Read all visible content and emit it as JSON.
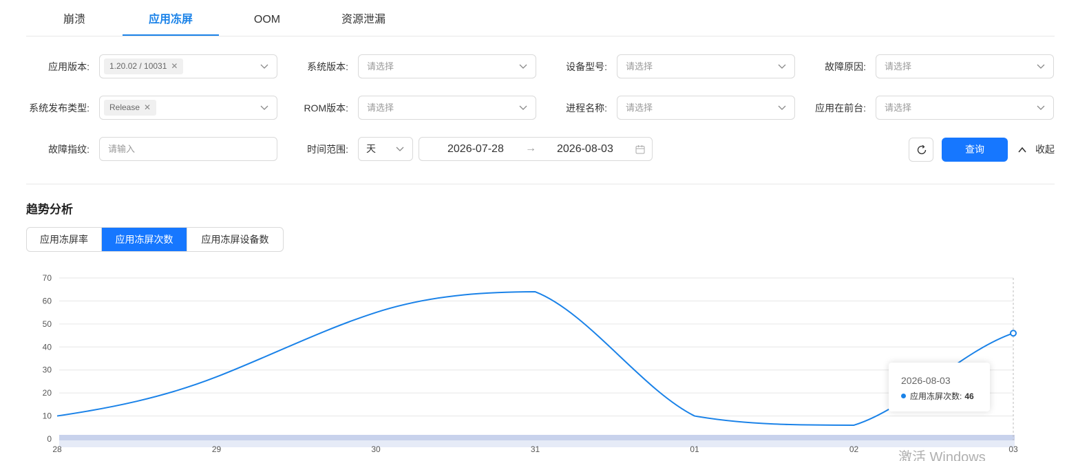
{
  "tabs": [
    {
      "label": "崩溃",
      "active": false
    },
    {
      "label": "应用冻屏",
      "active": true
    },
    {
      "label": "OOM",
      "active": false
    },
    {
      "label": "资源泄漏",
      "active": false
    }
  ],
  "filters": {
    "app_version": {
      "label": "应用版本:",
      "tag": "1.20.02 / 10031"
    },
    "os_version": {
      "label": "系统版本:",
      "placeholder": "请选择"
    },
    "device_model": {
      "label": "设备型号:",
      "placeholder": "请选择"
    },
    "fault_reason": {
      "label": "故障原因:",
      "placeholder": "请选择"
    },
    "release_type": {
      "label": "系统发布类型:",
      "tag": "Release"
    },
    "rom_version": {
      "label": "ROM版本:",
      "placeholder": "请选择"
    },
    "process_name": {
      "label": "进程名称:",
      "placeholder": "请选择"
    },
    "foreground": {
      "label": "应用在前台:",
      "placeholder": "请选择"
    },
    "fingerprint": {
      "label": "故障指纹:",
      "placeholder": "请输入"
    },
    "time_range": {
      "label": "时间范围:",
      "unit": "天",
      "start": "2026-07-28",
      "end": "2026-08-03",
      "separator": "→"
    }
  },
  "actions": {
    "query": "查询",
    "collapse": "收起"
  },
  "section_title": "趋势分析",
  "metric_tabs": [
    {
      "label": "应用冻屏率",
      "active": false
    },
    {
      "label": "应用冻屏次数",
      "active": true
    },
    {
      "label": "应用冻屏设备数",
      "active": false
    }
  ],
  "tooltip": {
    "date": "2026-08-03",
    "series": "应用冻屏次数:",
    "value": "46"
  },
  "watermark": "激活 Windows",
  "colors": {
    "accent": "#1677ff",
    "line": "#1a82e8"
  },
  "chart_data": {
    "type": "line",
    "x": [
      "28",
      "29",
      "30",
      "31",
      "01",
      "02",
      "03"
    ],
    "series": [
      {
        "name": "应用冻屏次数",
        "values": [
          10,
          27,
          55,
          64,
          10,
          6,
          46
        ]
      }
    ],
    "yticks": [
      0,
      10,
      20,
      30,
      40,
      50,
      60,
      70
    ],
    "ylim": [
      0,
      70
    ],
    "grid": true,
    "smooth": true
  }
}
